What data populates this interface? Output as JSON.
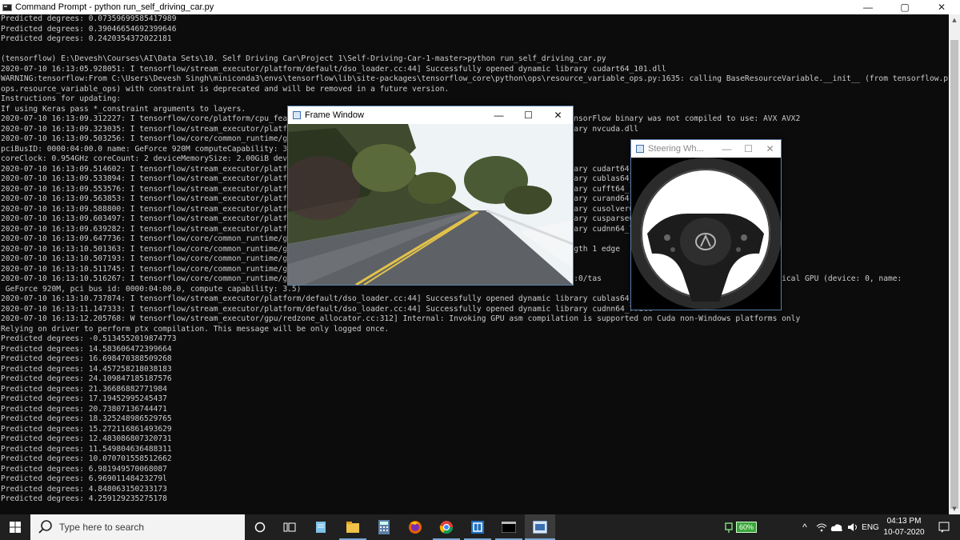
{
  "console_window": {
    "title": "Command Prompt - python  run_self_driving_car.py",
    "controls": {
      "minimize": "—",
      "maximize": "▢",
      "close": "✕"
    },
    "lines": [
      "Predicted degrees: 0.07359699585417989",
      "Predicted degrees: 0.39046654692399646",
      "Predicted degrees: 0.2420354372022181",
      "",
      "(tensorflow) E:\\Devesh\\Courses\\AI\\Data Sets\\10. Self Driving Car\\Project 1\\Self-Driving-Car-1-master>python run_self_driving_car.py",
      "2020-07-10 16:13:05.928051: I tensorflow/stream_executor/platform/default/dso_loader.cc:44] Successfully opened dynamic library cudart64_101.dll",
      "WARNING:tensorflow:From C:\\Users\\Devesh Singh\\miniconda3\\envs\\tensorflow\\lib\\site-packages\\tensorflow_core\\python\\ops\\resource_variable_ops.py:1635: calling BaseResourceVariable.__init__ (from tensorflow.python.",
      "ops.resource_variable_ops) with constraint is deprecated and will be removed in a future version.",
      "Instructions for updating:",
      "If using Keras pass *_constraint arguments to layers.",
      "2020-07-10 16:13:09.312227: I tensorflow/core/platform/cpu_feature_guard.cc:142] Your CPU supports instructions that this TensorFlow binary was not compiled to use: AVX AVX2",
      "2020-07-10 16:13:09.323035: I tensorflow/stream_executor/platform/default/dso_loader.cc:44] Successfully opened dynamic library nvcuda.dll",
      "2020-07-10 16:13:09.503256: I tensorflow/core/common_runtime/gpu",
      "pciBusID: 0000:04:00.0 name: GeForce 920M computeCapability: 3.5",
      "coreClock: 0.954GHz coreCount: 2 deviceMemorySize: 2.00GiB devic",
      "2020-07-10 16:13:09.514602: I tensorflow/stream_executor/platform/default/dso_loader.cc:44] Successfully opened dynamic library cudart64_101",
      "2020-07-10 16:13:09.533894: I tensorflow/stream_executor/platform/default/dso_loader.cc:44] Successfully opened dynamic library cublas64_10.",
      "2020-07-10 16:13:09.553576: I tensorflow/stream_executor/platform/default/dso_loader.cc:44] Successfully opened dynamic library cufft64_10.d",
      "2020-07-10 16:13:09.563853: I tensorflow/stream_executor/platform/default/dso_loader.cc:44] Successfully opened dynamic library curand64_10.",
      "2020-07-10 16:13:09.588800: I tensorflow/stream_executor/platform/default/dso_loader.cc:44] Successfully opened dynamic library cusolver64_1",
      "2020-07-10 16:13:09.603497: I tensorflow/stream_executor/platform/default/dso_loader.cc:44] Successfully opened dynamic library cusparse64_1",
      "2020-07-10 16:13:09.639282: I tensorflow/stream_executor/platform/default/dso_loader.cc:44] Successfully opened dynamic library cudnn64_7.dl",
      "2020-07-10 16:13:09.647736: I tensorflow/core/common_runtime/gpu",
      "2020-07-10 16:13:10.501363: I tensorflow/core/common_runtime/gpu                                                         rength 1 edge",
      "2020-07-10 16:13:10.507193: I tensorflow/core/common_runtime/gpu",
      "2020-07-10 16:13:10.511745: I tensorflow/core/common_runtime/gpu",
      "2020-07-10 16:13:10.516267: I tensorflow/core/common_runtime/gpu                                                    /replica:0/tas                           ory) -> physical GPU (device: 0, name:",
      " GeForce 920M, pci bus id: 0000:04:00.0, compute capability: 3.5)",
      "2020-07-10 16:13:10.737874: I tensorflow/stream_executor/platform/default/dso_loader.cc:44] Successfully opened dynamic library cublas64_10.",
      "2020-07-10 16:13:11.147333: I tensorflow/stream_executor/platform/default/dso_loader.cc:44] Successfully opened dynamic library cudnn64_7.dll",
      "2020-07-10 16:13:12.205768: W tensorflow/stream_executor/gpu/redzone_allocator.cc:312] Internal: Invoking GPU asm compilation is supported on Cuda non-Windows platforms only",
      "Relying on driver to perform ptx compilation. This message will be only logged once.",
      "Predicted degrees: -0.5134552019874773",
      "Predicted degrees: 14.583606472399664",
      "Predicted degrees: 16.698470388509268",
      "Predicted degrees: 14.457258218038183",
      "Predicted degrees: 24.109847185187576",
      "Predicted degrees: 21.36686882771984",
      "Predicted degrees: 17.19452995245437",
      "Predicted degrees: 20.73807136744471",
      "Predicted degrees: 18.325248986529765",
      "Predicted degrees: 15.272116861493629",
      "Predicted degrees: 12.483086807320731",
      "Predicted degrees: 11.549804636488311",
      "Predicted degrees: 10.070701558512662",
      "Predicted degrees: 6.981949570068087",
      "Predicted degrees: 6.96901148423279l",
      "Predicted degrees: 4.848063150233173",
      "Predicted degrees: 4.259129235275178"
    ]
  },
  "frame_window": {
    "title": "Frame Window",
    "controls": {
      "minimize": "—",
      "maximize": "☐",
      "close": "✕"
    }
  },
  "steering_window": {
    "title": "Steering Wh...",
    "controls": {
      "minimize": "—",
      "maximize": "☐",
      "close": "✕"
    }
  },
  "taskbar": {
    "search_placeholder": "Type here to search",
    "battery_percent": "60%",
    "language": "ENG",
    "time": "04:13 PM",
    "date": "10-07-2020",
    "icons": [
      "windows-start-icon",
      "search-icon",
      "task-view-icon",
      "timeline-icon",
      "notepad-icon",
      "file-explorer-icon",
      "calculator-icon",
      "firefox-icon",
      "chrome-icon",
      "app-icon",
      "cmd-icon",
      "python-window-icon"
    ]
  },
  "colors": {
    "console_bg": "#0c0c0c",
    "console_text": "#cccccc",
    "taskbar_bg": "#202020",
    "accent": "#7aa7d6"
  }
}
